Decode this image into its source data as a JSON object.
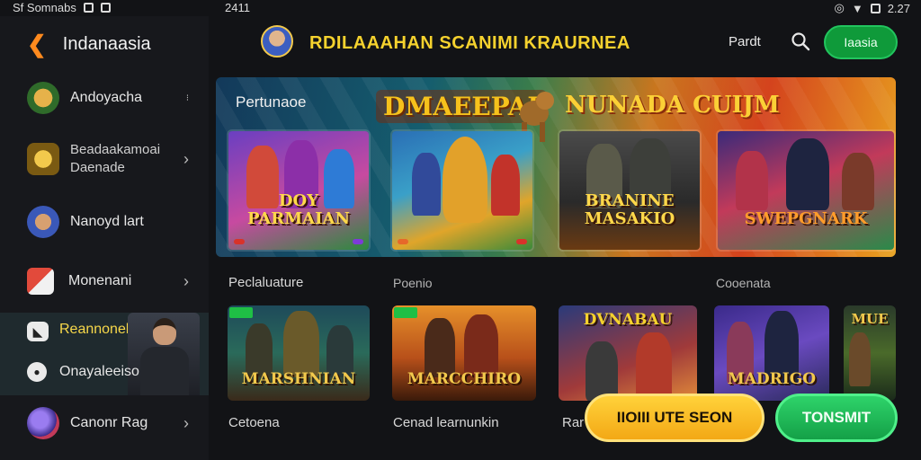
{
  "status_bar": {
    "left_text": "Sf Somnabs",
    "time_mid": "2411",
    "time_right": "2.27"
  },
  "sidebar": {
    "title": "Indanaasia",
    "items": [
      {
        "label": "Andoyacha",
        "icon": "character-icon",
        "chevron": false
      },
      {
        "label": "Beadaakamoai\nDaenade",
        "icon": "warrior-icon",
        "chevron": true
      },
      {
        "label": "Nanoyd lart",
        "icon": "hero-icon",
        "chevron": false
      },
      {
        "label": "Monenani",
        "icon": "cards-icon",
        "chevron": true
      },
      {
        "label": "Reannonekrean",
        "icon": "controller-icon",
        "chevron": false,
        "active": true
      },
      {
        "label": "Onayaleeiso",
        "icon": "gamepad-icon",
        "chevron": false
      },
      {
        "label": "Canonr Rag",
        "icon": "globe-icon",
        "chevron": true
      }
    ]
  },
  "header": {
    "brand": "RDILAAAHAN SCANIMI KRAURNEA",
    "link": "Pardt",
    "button": "Iaasia"
  },
  "banner": {
    "label": "Pertunaoe",
    "logo_left": "DMAEEPAI",
    "logo_right": "NUNADA CUIJM",
    "cards": [
      {
        "title": "DOY PARMAIAN"
      },
      {
        "title": ""
      },
      {
        "title": "BRANINE MASAKIO"
      },
      {
        "title": "SWEPGNARK"
      }
    ]
  },
  "section_labels": {
    "row2_left": "Peclaluature",
    "row2_mid": "Poenio",
    "row2_right": "Cooenata",
    "row3_left": "Cetoena",
    "row3_mid": "Cenad learnunkin",
    "row3_right": "Rar"
  },
  "games": [
    {
      "title": "MARSHNIAN"
    },
    {
      "title": "MARCCHIRO"
    },
    {
      "title": "DVNABAU"
    },
    {
      "title": "MADRIGO"
    },
    {
      "title": "MUE"
    }
  ],
  "cta": {
    "primary": "IIOIII UTE SEON",
    "secondary": "TONSMIT"
  },
  "colors": {
    "accent_yellow": "#f5d22e",
    "accent_green": "#1fbf45",
    "back_arrow": "#ff8a1e"
  }
}
